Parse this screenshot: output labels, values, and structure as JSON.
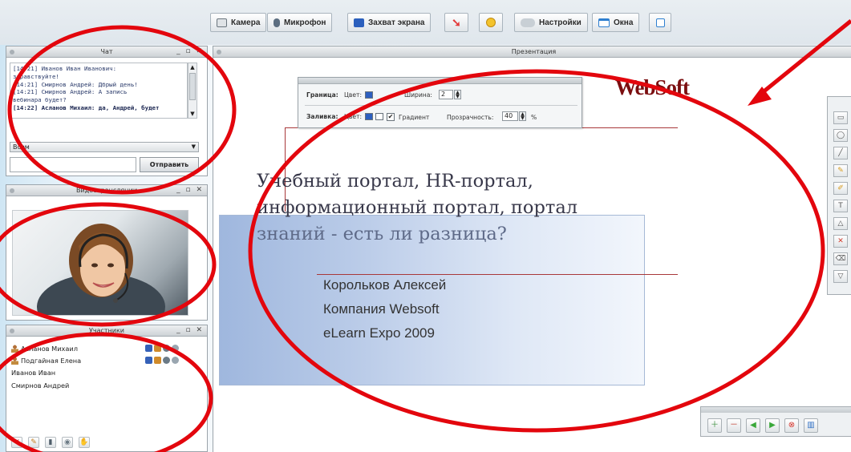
{
  "toolbar": {
    "camera": "Камера",
    "microphone": "Микрофон",
    "screen_capture": "Захват экрана",
    "settings": "Настройки",
    "windows": "Окна"
  },
  "chat": {
    "title": "Чат",
    "messages": [
      "[14:21] Иванов Иван Иванович:",
      "здравствуйте!",
      "[14:21] Смирнов Андрей: Дбрый день!",
      "[14:21] Смирнов Андрей: А запись",
      "вебинара будет?",
      "[14:22] Асланов Михаил: да, Андрей, будет"
    ],
    "recipient": "Всем",
    "send_label": "Отправить"
  },
  "video": {
    "title": "Видеотрансляции"
  },
  "participants": {
    "title": "Участники",
    "list": [
      "Асланов Михаил",
      "Подгайная Елена",
      "Иванов Иван",
      "Смирнов Андрей"
    ]
  },
  "presentation": {
    "title": "Презентация",
    "logo": "WebSoft",
    "slide_title_1": "Учебный портал, HR-портал,",
    "slide_title_2": "информационный портал, портал",
    "slide_title_3": "знаний - есть ли разница?",
    "slide_sub": [
      "Корольков Алексей",
      "Компания Websoft",
      "eLearn Expo 2009"
    ]
  },
  "properties": {
    "border_label": "Граница:",
    "fill_label": "Заливка:",
    "color_label": "Цвет:",
    "width_label": "Ширина:",
    "width_value": "2",
    "gradient_label": "Градиент",
    "opacity_label": "Прозрачность:",
    "opacity_value": "40",
    "percent": "%"
  },
  "colors": {
    "annotation_red": "#e3060d",
    "logo": "#7b0e10",
    "accent_blue": "#2e5fbf"
  },
  "icons": [
    "camera-icon",
    "microphone-icon",
    "screen-capture-icon",
    "pointer-icon",
    "smiley-icon",
    "settings-icon",
    "windows-icon",
    "layout-icon"
  ]
}
